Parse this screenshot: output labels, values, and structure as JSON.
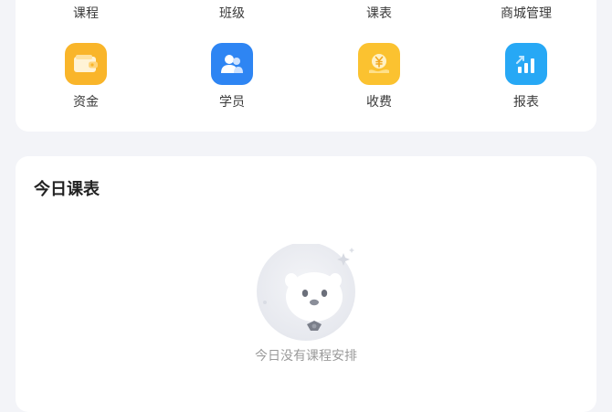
{
  "menu_row1": [
    {
      "label": "课程"
    },
    {
      "label": "班级"
    },
    {
      "label": "课表"
    },
    {
      "label": "商城管理"
    }
  ],
  "menu_row2": [
    {
      "label": "资金",
      "icon": "wallet-icon",
      "color": "#f9b52a"
    },
    {
      "label": "学员",
      "icon": "students-icon",
      "color": "#2e85f3"
    },
    {
      "label": "收费",
      "icon": "yen-coin-icon",
      "color": "#fbc230"
    },
    {
      "label": "报表",
      "icon": "report-chart-icon",
      "color": "#27a8f5"
    }
  ],
  "schedule": {
    "title": "今日课表",
    "empty_text": "今日没有课程安排",
    "empty_icon": "empty-mascot-illustration"
  }
}
